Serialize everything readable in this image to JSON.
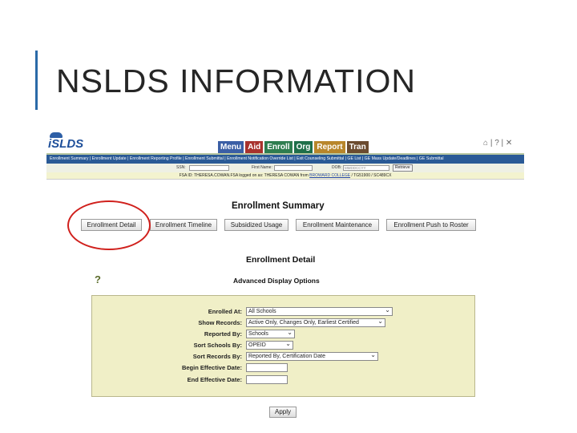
{
  "slide": {
    "title": "NSLDS INFORMATION"
  },
  "header": {
    "logo_text": "iSLDS",
    "tabs": [
      "Menu",
      "Aid",
      "Enroll",
      "Org",
      "Report",
      "Tran"
    ],
    "icons_text": "⌂ | ? | ✕"
  },
  "navbar": {
    "items": [
      "Enrollment Summary",
      "Enrollment Update",
      "Enrollment Reporting Profile",
      "Enrollment Submittal",
      "Enrollment Notification Override List",
      "Exit Counseling Submittal",
      "GE List",
      "GE Mass Update/Deadlines",
      "GE Submittal"
    ]
  },
  "search": {
    "ssn_label": "SSN:",
    "first_name_label": "First Name:",
    "dob_label": "DOB:",
    "dob_placeholder": "MMDDCCYY",
    "retrieve_label": "Retrieve"
  },
  "info_bar": {
    "prefix": "FSA ID: THERESA.COWAN.FSA logged on as: THERESA COWAN from",
    "school": "BROWARD COLLEGE",
    "suffix": "/ TG51900 / SC489CX"
  },
  "summary": {
    "title": "Enrollment Summary",
    "buttons": [
      "Enrollment Detail",
      "Enrollment Timeline",
      "Subsidized Usage",
      "Enrollment Maintenance",
      "Enrollment Push to Roster"
    ]
  },
  "detail": {
    "title": "Enrollment Detail",
    "help_icon": "?",
    "advanced_title": "Advanced Display Options",
    "fields": [
      {
        "label": "Enrolled At:",
        "value": "All Schools"
      },
      {
        "label": "Show Records:",
        "value": "Active Only, Changes Only, Earliest Certified"
      },
      {
        "label": "Reported By:",
        "value": "Schools"
      },
      {
        "label": "Sort Schools By:",
        "value": "OPEID"
      },
      {
        "label": "Sort Records By:",
        "value": "Reported By, Certification Date"
      },
      {
        "label": "Begin Effective Date:",
        "value": ""
      },
      {
        "label": "End Effective Date:",
        "value": ""
      }
    ],
    "apply_label": "Apply"
  },
  "colors": {
    "accent": "#2a6aa8",
    "highlight": "#d0201c",
    "nav": "#2a5a96",
    "panel": "#f0efc7"
  }
}
